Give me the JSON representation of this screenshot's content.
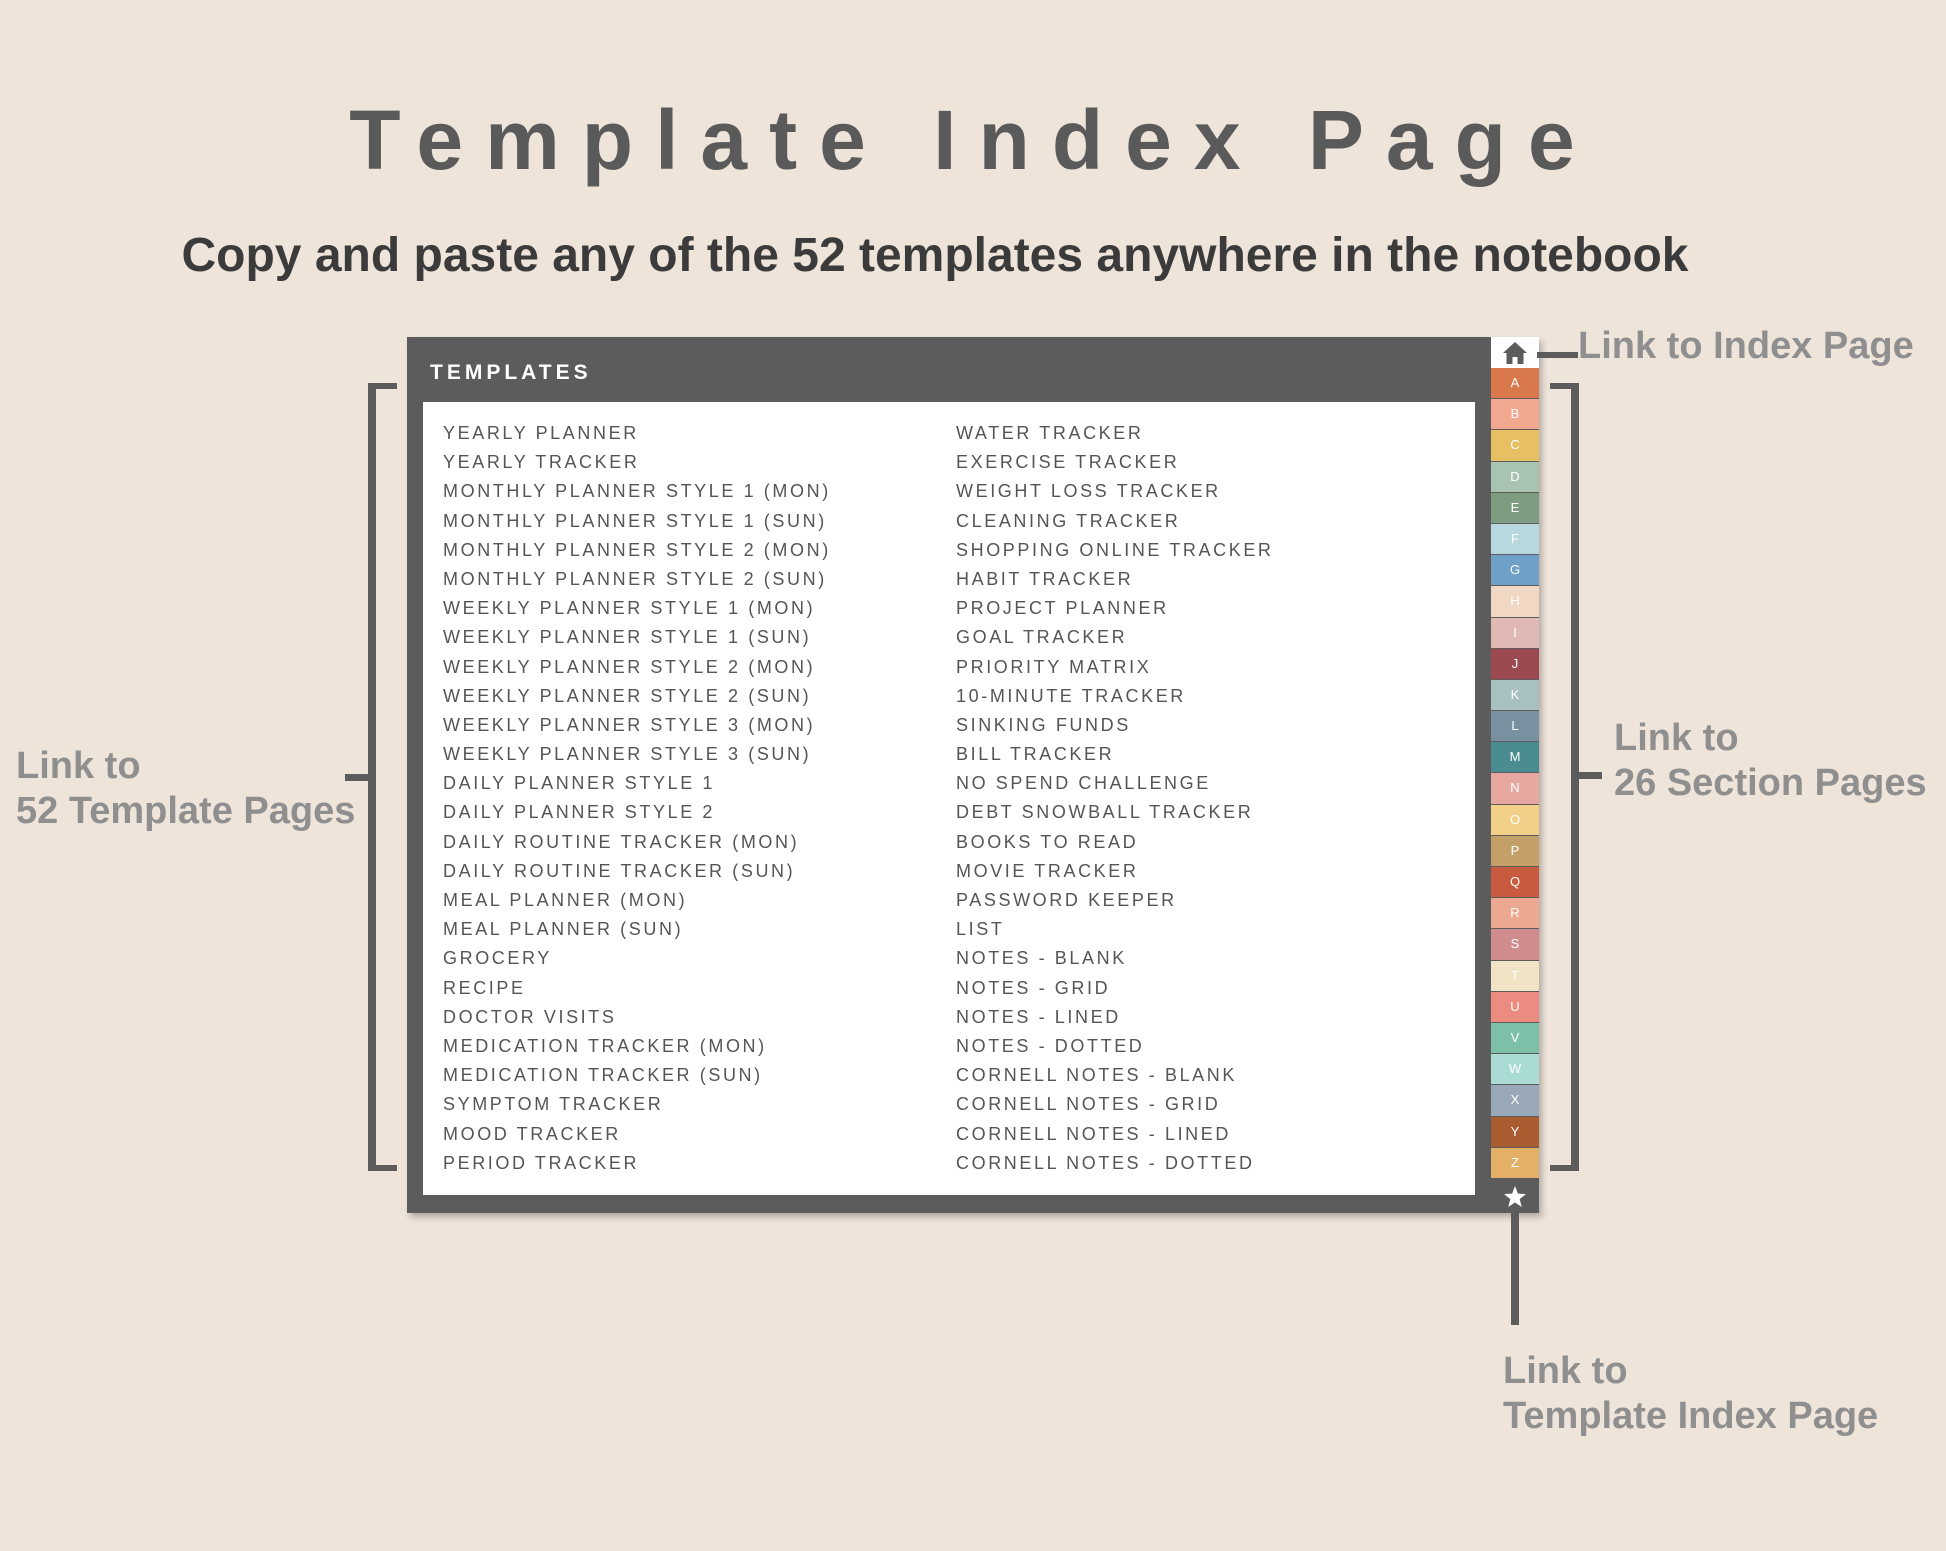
{
  "title": "Template Index Page",
  "subtitle": "Copy and paste any of the 52 templates anywhere in the notebook",
  "panel": {
    "header": "TEMPLATES",
    "left_column": [
      "YEARLY PLANNER",
      "YEARLY TRACKER",
      "MONTHLY PLANNER STYLE 1 (MON)",
      "MONTHLY PLANNER STYLE 1 (SUN)",
      "MONTHLY PLANNER STYLE 2 (MON)",
      "MONTHLY PLANNER STYLE 2 (SUN)",
      "WEEKLY PLANNER STYLE 1 (MON)",
      "WEEKLY PLANNER STYLE 1 (SUN)",
      "WEEKLY PLANNER STYLE 2 (MON)",
      "WEEKLY PLANNER STYLE 2 (SUN)",
      "WEEKLY PLANNER STYLE 3 (MON)",
      "WEEKLY PLANNER STYLE 3 (SUN)",
      "DAILY PLANNER STYLE 1",
      "DAILY PLANNER STYLE 2",
      "DAILY ROUTINE TRACKER (MON)",
      "DAILY ROUTINE TRACKER (SUN)",
      "MEAL PLANNER (MON)",
      "MEAL PLANNER (SUN)",
      "GROCERY",
      "RECIPE",
      "DOCTOR VISITS",
      "MEDICATION TRACKER (MON)",
      "MEDICATION TRACKER (SUN)",
      "SYMPTOM TRACKER",
      "MOOD TRACKER",
      "PERIOD TRACKER"
    ],
    "right_column": [
      "WATER TRACKER",
      "EXERCISE TRACKER",
      "WEIGHT LOSS TRACKER",
      "CLEANING TRACKER",
      "SHOPPING ONLINE TRACKER",
      "HABIT TRACKER",
      "PROJECT PLANNER",
      "GOAL TRACKER",
      "PRIORITY MATRIX",
      "10-MINUTE TRACKER",
      "SINKING FUNDS",
      "BILL TRACKER",
      "NO SPEND CHALLENGE",
      "DEBT SNOWBALL TRACKER",
      "BOOKS TO READ",
      "MOVIE TRACKER",
      "PASSWORD KEEPER",
      "LIST",
      "NOTES - BLANK",
      "NOTES - GRID",
      "NOTES - LINED",
      "NOTES - DOTTED",
      "CORNELL NOTES - BLANK",
      "CORNELL NOTES - GRID",
      "CORNELL NOTES - LINED",
      "CORNELL NOTES - DOTTED"
    ]
  },
  "tabs": {
    "home_icon": "home-icon",
    "star_icon": "star-icon",
    "letters": [
      {
        "label": "A",
        "color": "#d9784a"
      },
      {
        "label": "B",
        "color": "#f2a88f"
      },
      {
        "label": "C",
        "color": "#e8c064"
      },
      {
        "label": "D",
        "color": "#a8c4b0"
      },
      {
        "label": "E",
        "color": "#7e9c80"
      },
      {
        "label": "F",
        "color": "#b8d8e0"
      },
      {
        "label": "G",
        "color": "#6fa0c8"
      },
      {
        "label": "H",
        "color": "#f0d8c4"
      },
      {
        "label": "I",
        "color": "#e0b8b4"
      },
      {
        "label": "J",
        "color": "#9c4a50"
      },
      {
        "label": "K",
        "color": "#a8c0c0"
      },
      {
        "label": "L",
        "color": "#7890a0"
      },
      {
        "label": "M",
        "color": "#4a8c90"
      },
      {
        "label": "N",
        "color": "#e6a8a0"
      },
      {
        "label": "O",
        "color": "#f2d088"
      },
      {
        "label": "P",
        "color": "#c4a068"
      },
      {
        "label": "Q",
        "color": "#c85a40"
      },
      {
        "label": "R",
        "color": "#eca890"
      },
      {
        "label": "S",
        "color": "#d08c8c"
      },
      {
        "label": "T",
        "color": "#f0e4c4"
      },
      {
        "label": "U",
        "color": "#ec8c80"
      },
      {
        "label": "V",
        "color": "#7cc0a8"
      },
      {
        "label": "W",
        "color": "#a8dcd4"
      },
      {
        "label": "X",
        "color": "#98a8b8"
      },
      {
        "label": "Y",
        "color": "#a85c30"
      },
      {
        "label": "Z",
        "color": "#e4b068"
      }
    ]
  },
  "annotations": {
    "index_link": "Link to Index Page",
    "template_pages_line1": "Link to",
    "template_pages_line2": "52 Template Pages",
    "section_pages_line1": "Link to",
    "section_pages_line2": "26 Section Pages",
    "template_index_line1": "Link to",
    "template_index_line2": "Template Index Page"
  }
}
